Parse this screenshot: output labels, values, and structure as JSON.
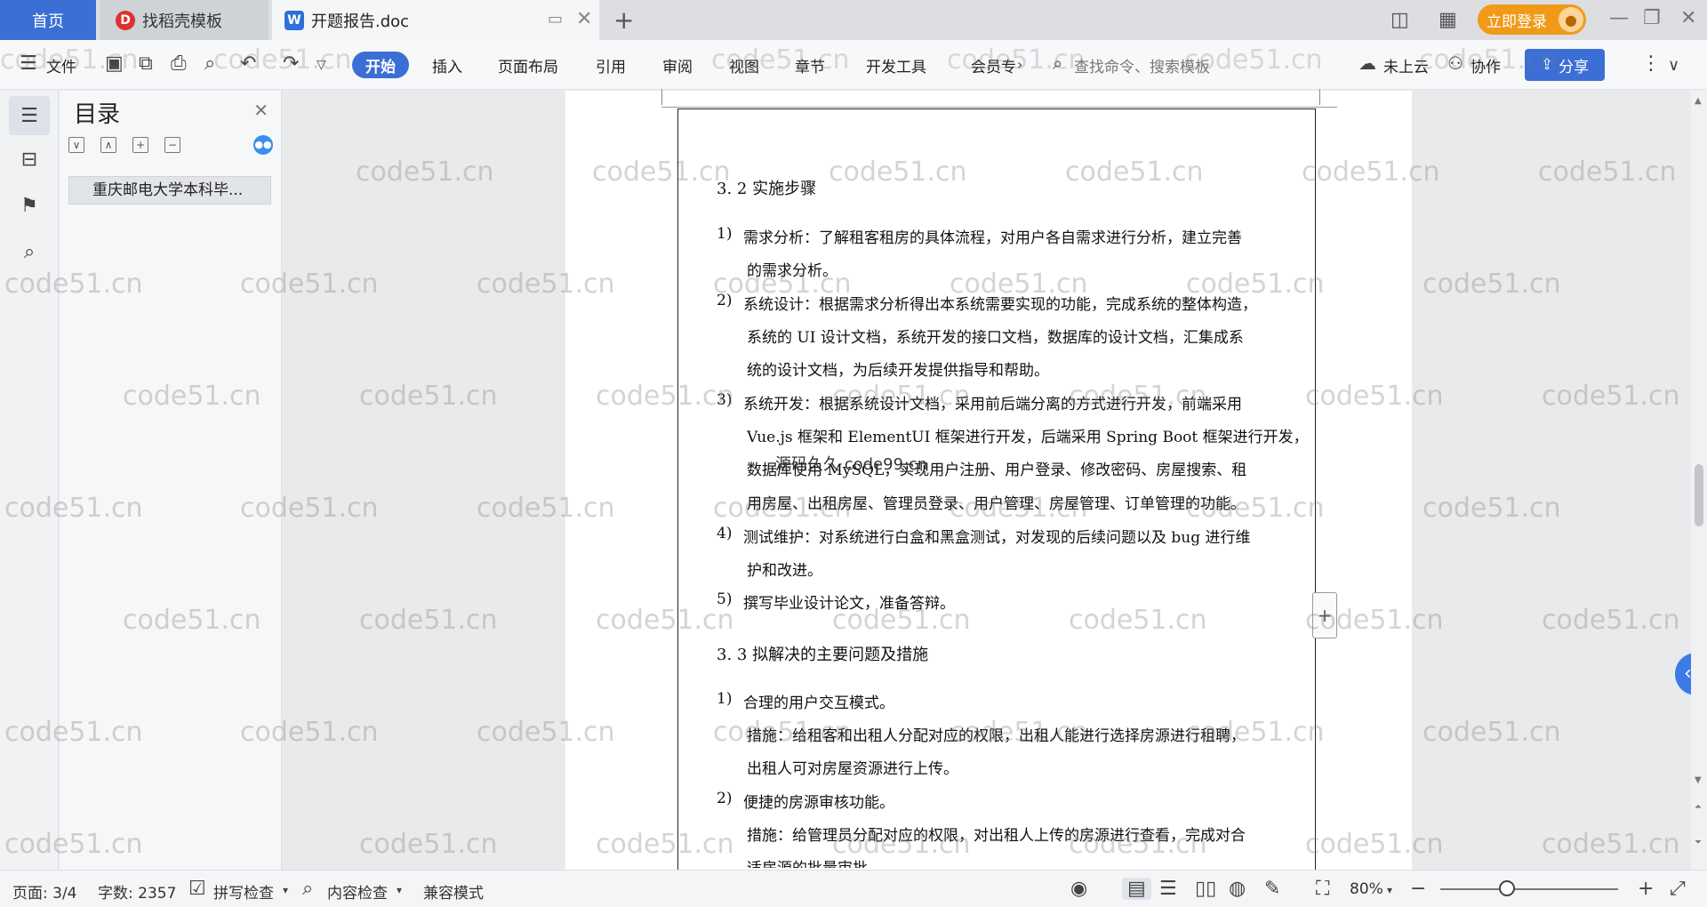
{
  "tabs": {
    "home": "首页",
    "templates": "找稻壳模板",
    "document": "开题报告.doc"
  },
  "titlebar": {
    "login": "立即登录"
  },
  "ribbon": {
    "file": "文件",
    "menus": [
      "开始",
      "插入",
      "页面布局",
      "引用",
      "审阅",
      "视图",
      "章节",
      "开发工具",
      "会员专"
    ],
    "search_placeholder": "查找命令、搜索模板",
    "cloud": "未上云",
    "collaborate": "协作",
    "share": "分享"
  },
  "toc": {
    "title": "目录",
    "item": "重庆邮电大学本科毕..."
  },
  "document": {
    "heading_1": "3. 2 实施步骤",
    "items_1": [
      {
        "num": "1)",
        "lines": [
          "需求分析：了解租客租房的具体流程，对用户各自需求进行分析，建立完善",
          "的需求分析。"
        ]
      },
      {
        "num": "2)",
        "lines": [
          "系统设计：根据需求分析得出本系统需要实现的功能，完成系统的整体构造，",
          "系统的 UI 设计文档，系统开发的接口文档，数据库的设计文档，汇集成系",
          "统的设计文档，为后续开发提供指导和帮助。"
        ]
      },
      {
        "num": "3)",
        "lines": [
          "系统开发：根据系统设计文档，采用前后端分离的方式进行开发，前端采用",
          "Vue.js 框架和 ElementUI 框架进行开发，后端采用 Spring Boot 框架进行开发，",
          "数据库使用 MySQL，实现用户注册、用户登录、修改密码、房屋搜索、租",
          "用房屋、出租房屋、管理员登录、用户管理、房屋管理、订单管理的功能。"
        ]
      },
      {
        "num": "4)",
        "lines": [
          "测试维护：对系统进行白盒和黑盒测试，对发现的后续问题以及 bug 进行维",
          "护和改进。"
        ]
      },
      {
        "num": "5)",
        "lines": [
          "撰写毕业设计论文，准备答辩。"
        ]
      }
    ],
    "heading_2": "3. 3 拟解决的主要问题及措施",
    "items_2": [
      {
        "num": "1)",
        "lines": [
          "合理的用户交互模式。",
          "措施：给租客和出租人分配对应的权限，出租人能进行选择房源进行租聘，",
          "出租人可对房屋资源进行上传。"
        ]
      },
      {
        "num": "2)",
        "lines": [
          "便捷的房源审核功能。",
          "措施：给管理员分配对应的权限，对出租人上传的房源进行查看，完成对合",
          "适房源的批量审批。"
        ]
      }
    ]
  },
  "watermark": {
    "text": "code51.cn",
    "overlay": "源码久久 code99.cn"
  },
  "statusbar": {
    "page": "页面: 3/4",
    "words": "字数: 2357",
    "spell": "拼写检查",
    "content_check": "内容检查",
    "compat": "兼容模式",
    "zoom": "80%"
  },
  "colors": {
    "accent": "#3c6fd6",
    "login": "#f19a1a"
  }
}
